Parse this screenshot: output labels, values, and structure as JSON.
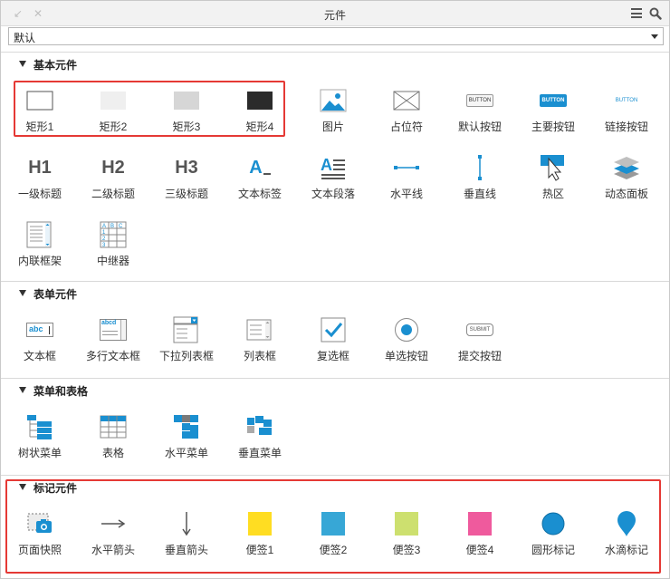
{
  "window": {
    "title": "元件"
  },
  "library_select": {
    "value": "默认"
  },
  "colors": {
    "accent": "#1a8fd0",
    "highlight_box": "#e53935"
  },
  "sections": [
    {
      "title": "基本元件",
      "items": [
        {
          "label": "矩形1",
          "icon": "rect-white-icon"
        },
        {
          "label": "矩形2",
          "icon": "rect-light-icon"
        },
        {
          "label": "矩形3",
          "icon": "rect-gray-icon"
        },
        {
          "label": "矩形4",
          "icon": "rect-dark-icon"
        },
        {
          "label": "图片",
          "icon": "image-icon"
        },
        {
          "label": "占位符",
          "icon": "placeholder-icon"
        },
        {
          "label": "默认按钮",
          "icon": "default-button-icon",
          "icon_text": "BUTTON"
        },
        {
          "label": "主要按钮",
          "icon": "primary-button-icon",
          "icon_text": "BUTTON"
        },
        {
          "label": "链接按钮",
          "icon": "link-button-icon",
          "icon_text": "BUTTON"
        },
        {
          "label": "一级标题",
          "icon": "h1-icon",
          "icon_text": "H1"
        },
        {
          "label": "二级标题",
          "icon": "h2-icon",
          "icon_text": "H2"
        },
        {
          "label": "三级标题",
          "icon": "h3-icon",
          "icon_text": "H3"
        },
        {
          "label": "文本标签",
          "icon": "text-label-icon",
          "icon_text": "A"
        },
        {
          "label": "文本段落",
          "icon": "text-paragraph-icon",
          "icon_text": "A"
        },
        {
          "label": "水平线",
          "icon": "horizontal-line-icon"
        },
        {
          "label": "垂直线",
          "icon": "vertical-line-icon"
        },
        {
          "label": "热区",
          "icon": "hotspot-icon"
        },
        {
          "label": "动态面板",
          "icon": "dynamic-panel-icon"
        },
        {
          "label": "内联框架",
          "icon": "inline-frame-icon"
        },
        {
          "label": "中继器",
          "icon": "repeater-icon",
          "icon_text": "A B C 1 2 3"
        }
      ]
    },
    {
      "title": "表单元件",
      "items": [
        {
          "label": "文本框",
          "icon": "text-field-icon",
          "icon_text": "abc"
        },
        {
          "label": "多行文本框",
          "icon": "textarea-icon",
          "icon_text": "abcd"
        },
        {
          "label": "下拉列表框",
          "icon": "droplist-icon"
        },
        {
          "label": "列表框",
          "icon": "listbox-icon"
        },
        {
          "label": "复选框",
          "icon": "checkbox-icon"
        },
        {
          "label": "单选按钮",
          "icon": "radio-button-icon"
        },
        {
          "label": "提交按钮",
          "icon": "submit-button-icon",
          "icon_text": "SUBMIT"
        }
      ]
    },
    {
      "title": "菜单和表格",
      "items": [
        {
          "label": "树状菜单",
          "icon": "tree-menu-icon"
        },
        {
          "label": "表格",
          "icon": "table-icon"
        },
        {
          "label": "水平菜单",
          "icon": "horizontal-menu-icon"
        },
        {
          "label": "垂直菜单",
          "icon": "vertical-menu-icon"
        }
      ]
    },
    {
      "title": "标记元件",
      "items": [
        {
          "label": "页面快照",
          "icon": "snapshot-icon"
        },
        {
          "label": "水平箭头",
          "icon": "horizontal-arrow-icon"
        },
        {
          "label": "垂直箭头",
          "icon": "vertical-arrow-icon"
        },
        {
          "label": "便签1",
          "icon": "sticky-yellow-icon",
          "color": "#ffdd22"
        },
        {
          "label": "便签2",
          "icon": "sticky-blue-icon",
          "color": "#37a7d6"
        },
        {
          "label": "便签3",
          "icon": "sticky-green-icon",
          "color": "#cde06f"
        },
        {
          "label": "便签4",
          "icon": "sticky-pink-icon",
          "color": "#ef5a9d"
        },
        {
          "label": "圆形标记",
          "icon": "circle-marker-icon",
          "color": "#1a8fd0"
        },
        {
          "label": "水滴标记",
          "icon": "drop-marker-icon",
          "color": "#1a8fd0"
        }
      ]
    }
  ]
}
